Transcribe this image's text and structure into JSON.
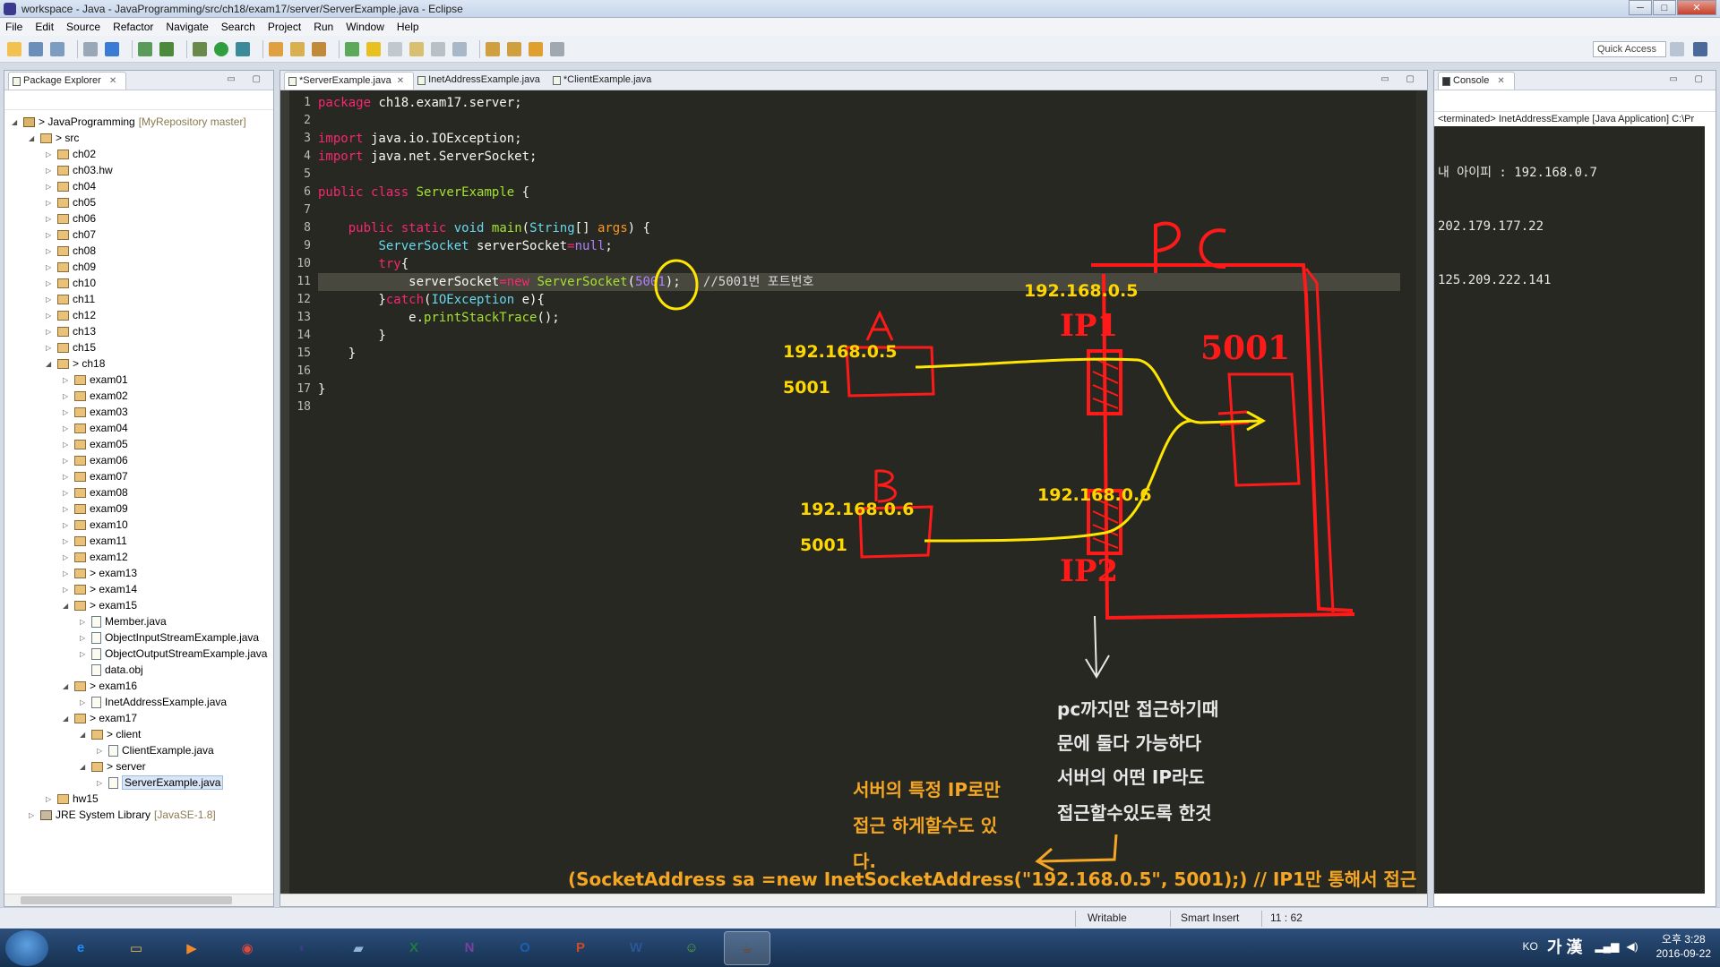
{
  "window": {
    "title": "workspace - Java - JavaProgramming/src/ch18/exam17/server/ServerExample.java - Eclipse",
    "controls": [
      "─",
      "□",
      "✕"
    ]
  },
  "menu": [
    "File",
    "Edit",
    "Source",
    "Refactor",
    "Navigate",
    "Search",
    "Project",
    "Run",
    "Window",
    "Help"
  ],
  "toolbar": {
    "quick_access": "Quick Access"
  },
  "package_explorer": {
    "tab_label": "Package Explorer",
    "close_glyph": "✕",
    "items": [
      {
        "label": "> JavaProgramming",
        "decoration": "[MyRepository master]",
        "depth": 0,
        "type": "proj",
        "arrow": "◢"
      },
      {
        "label": "> src",
        "depth": 1,
        "type": "pkg",
        "arrow": "◢"
      },
      {
        "label": "ch02",
        "depth": 2,
        "type": "pkg",
        "arrow": "▷"
      },
      {
        "label": "ch03.hw",
        "depth": 2,
        "type": "pkg",
        "arrow": "▷"
      },
      {
        "label": "ch04",
        "depth": 2,
        "type": "pkg",
        "arrow": "▷"
      },
      {
        "label": "ch05",
        "depth": 2,
        "type": "pkg",
        "arrow": "▷"
      },
      {
        "label": "ch06",
        "depth": 2,
        "type": "pkg",
        "arrow": "▷"
      },
      {
        "label": "ch07",
        "depth": 2,
        "type": "pkg",
        "arrow": "▷"
      },
      {
        "label": "ch08",
        "depth": 2,
        "type": "pkg",
        "arrow": "▷"
      },
      {
        "label": "ch09",
        "depth": 2,
        "type": "pkg",
        "arrow": "▷"
      },
      {
        "label": "ch10",
        "depth": 2,
        "type": "pkg",
        "arrow": "▷"
      },
      {
        "label": "ch11",
        "depth": 2,
        "type": "pkg",
        "arrow": "▷"
      },
      {
        "label": "ch12",
        "depth": 2,
        "type": "pkg",
        "arrow": "▷"
      },
      {
        "label": "ch13",
        "depth": 2,
        "type": "pkg",
        "arrow": "▷"
      },
      {
        "label": "ch15",
        "depth": 2,
        "type": "pkg",
        "arrow": "▷"
      },
      {
        "label": "> ch18",
        "depth": 2,
        "type": "pkg",
        "arrow": "◢"
      },
      {
        "label": "exam01",
        "depth": 3,
        "type": "pkg",
        "arrow": "▷"
      },
      {
        "label": "exam02",
        "depth": 3,
        "type": "pkg",
        "arrow": "▷"
      },
      {
        "label": "exam03",
        "depth": 3,
        "type": "pkg",
        "arrow": "▷"
      },
      {
        "label": "exam04",
        "depth": 3,
        "type": "pkg",
        "arrow": "▷"
      },
      {
        "label": "exam05",
        "depth": 3,
        "type": "pkg",
        "arrow": "▷"
      },
      {
        "label": "exam06",
        "depth": 3,
        "type": "pkg",
        "arrow": "▷"
      },
      {
        "label": "exam07",
        "depth": 3,
        "type": "pkg",
        "arrow": "▷"
      },
      {
        "label": "exam08",
        "depth": 3,
        "type": "pkg",
        "arrow": "▷"
      },
      {
        "label": "exam09",
        "depth": 3,
        "type": "pkg",
        "arrow": "▷"
      },
      {
        "label": "exam10",
        "depth": 3,
        "type": "pkg",
        "arrow": "▷"
      },
      {
        "label": "exam11",
        "depth": 3,
        "type": "pkg",
        "arrow": "▷"
      },
      {
        "label": "exam12",
        "depth": 3,
        "type": "pkg",
        "arrow": "▷"
      },
      {
        "label": "> exam13",
        "depth": 3,
        "type": "pkg",
        "arrow": "▷"
      },
      {
        "label": "> exam14",
        "depth": 3,
        "type": "pkg",
        "arrow": "▷"
      },
      {
        "label": "> exam15",
        "depth": 3,
        "type": "pkg",
        "arrow": "◢"
      },
      {
        "label": "Member.java",
        "depth": 4,
        "type": "file",
        "arrow": "▷"
      },
      {
        "label": "ObjectInputStreamExample.java",
        "depth": 4,
        "type": "file",
        "arrow": "▷"
      },
      {
        "label": "ObjectOutputStreamExample.java",
        "depth": 4,
        "type": "file",
        "arrow": "▷"
      },
      {
        "label": "data.obj",
        "depth": 4,
        "type": "file",
        "arrow": ""
      },
      {
        "label": "> exam16",
        "depth": 3,
        "type": "pkg",
        "arrow": "◢"
      },
      {
        "label": "InetAddressExample.java",
        "depth": 4,
        "type": "file",
        "arrow": "▷"
      },
      {
        "label": "> exam17",
        "depth": 3,
        "type": "pkg",
        "arrow": "◢"
      },
      {
        "label": "> client",
        "depth": 4,
        "type": "pkg",
        "arrow": "◢"
      },
      {
        "label": "ClientExample.java",
        "depth": 5,
        "type": "file",
        "arrow": "▷"
      },
      {
        "label": "> server",
        "depth": 4,
        "type": "pkg",
        "arrow": "◢"
      },
      {
        "label": "ServerExample.java",
        "depth": 5,
        "type": "file",
        "arrow": "▷",
        "selected": true
      },
      {
        "label": "hw15",
        "depth": 2,
        "type": "pkg",
        "arrow": "▷"
      },
      {
        "label": "JRE System Library",
        "decoration": "[JavaSE-1.8]",
        "depth": 1,
        "type": "lib",
        "arrow": "▷"
      }
    ]
  },
  "editor": {
    "tabs": [
      {
        "label": "*ServerExample.java",
        "active": true,
        "close": "✕"
      },
      {
        "label": "InetAddressExample.java",
        "active": false,
        "close": ""
      },
      {
        "label": "*ClientExample.java",
        "active": false,
        "close": ""
      }
    ],
    "line_numbers": [
      "1",
      "2",
      "3",
      "4",
      "5",
      "6",
      "7",
      "8",
      "9",
      "10",
      "11",
      "12",
      "13",
      "14",
      "15",
      "16",
      "17",
      "18"
    ],
    "highlighted_line": 11,
    "lines": [
      [
        {
          "t": "package",
          "c": "kw"
        },
        {
          "t": " ch18.exam17.server;",
          "c": "pu"
        }
      ],
      [],
      [
        {
          "t": "import",
          "c": "kw"
        },
        {
          "t": " java.io.IOException;",
          "c": "pu"
        }
      ],
      [
        {
          "t": "import",
          "c": "kw"
        },
        {
          "t": " java.net.ServerSocket;",
          "c": "pu"
        }
      ],
      [],
      [
        {
          "t": "public",
          "c": "kw"
        },
        {
          "t": " ",
          "c": "pu"
        },
        {
          "t": "class",
          "c": "kw"
        },
        {
          "t": " ",
          "c": "pu"
        },
        {
          "t": "ServerExample",
          "c": "fn"
        },
        {
          "t": " {",
          "c": "pu"
        }
      ],
      [],
      [
        {
          "t": "    ",
          "c": "pu"
        },
        {
          "t": "public",
          "c": "kw"
        },
        {
          "t": " ",
          "c": "pu"
        },
        {
          "t": "static",
          "c": "kw"
        },
        {
          "t": " ",
          "c": "pu"
        },
        {
          "t": "void",
          "c": "ty"
        },
        {
          "t": " ",
          "c": "pu"
        },
        {
          "t": "main",
          "c": "fn"
        },
        {
          "t": "(",
          "c": "pu"
        },
        {
          "t": "String",
          "c": "ty"
        },
        {
          "t": "[] ",
          "c": "pu"
        },
        {
          "t": "args",
          "c": "vr"
        },
        {
          "t": ") {",
          "c": "pu"
        }
      ],
      [
        {
          "t": "        ",
          "c": "pu"
        },
        {
          "t": "ServerSocket",
          "c": "ty"
        },
        {
          "t": " serverSocket",
          "c": "pu"
        },
        {
          "t": "=",
          "c": "kw"
        },
        {
          "t": "null",
          "c": "nm"
        },
        {
          "t": ";",
          "c": "pu"
        }
      ],
      [
        {
          "t": "        ",
          "c": "pu"
        },
        {
          "t": "try",
          "c": "kw"
        },
        {
          "t": "{",
          "c": "pu"
        }
      ],
      [
        {
          "t": "            serverSocket",
          "c": "pu"
        },
        {
          "t": "=",
          "c": "kw"
        },
        {
          "t": "new",
          "c": "kw"
        },
        {
          "t": " ",
          "c": "pu"
        },
        {
          "t": "ServerSocket",
          "c": "fn"
        },
        {
          "t": "(",
          "c": "pu"
        },
        {
          "t": "5001",
          "c": "nm"
        },
        {
          "t": ");",
          "c": "pu"
        },
        {
          "t": "   //5001번 포트번호",
          "c": "cm"
        }
      ],
      [
        {
          "t": "        }",
          "c": "pu"
        },
        {
          "t": "catch",
          "c": "kw"
        },
        {
          "t": "(",
          "c": "pu"
        },
        {
          "t": "IOException",
          "c": "ty"
        },
        {
          "t": " e){",
          "c": "pu"
        }
      ],
      [
        {
          "t": "            e.",
          "c": "pu"
        },
        {
          "t": "printStackTrace",
          "c": "fn"
        },
        {
          "t": "();",
          "c": "pu"
        }
      ],
      [
        {
          "t": "        }",
          "c": "pu"
        }
      ],
      [
        {
          "t": "    }",
          "c": "pu"
        }
      ],
      [],
      [
        {
          "t": "}",
          "c": "pu"
        }
      ],
      []
    ]
  },
  "console": {
    "tab_label": "Console",
    "close_glyph": "✕",
    "terminated": "<terminated> InetAddressExample [Java Application] C:\\Pr",
    "output": [
      "내 아이피 : 192.168.0.7",
      "202.179.177.22",
      "125.209.222.141"
    ]
  },
  "statusbar": {
    "writable": "Writable",
    "insert_mode": "Smart Insert",
    "position": "11 : 62"
  },
  "taskbar": {
    "apps": [
      {
        "name": "internet-explorer",
        "glyph": "e",
        "color": "#1e90ff"
      },
      {
        "name": "file-explorer",
        "glyph": "▭",
        "color": "#e8b84a"
      },
      {
        "name": "media-player",
        "glyph": "▶",
        "color": "#f08a2c"
      },
      {
        "name": "chrome",
        "glyph": "◉",
        "color": "#e04a3c"
      },
      {
        "name": "eclipse",
        "glyph": "◐",
        "color": "#3b3a8f"
      },
      {
        "name": "notes",
        "glyph": "▰",
        "color": "#8fb6d8"
      },
      {
        "name": "excel",
        "glyph": "X",
        "color": "#1f7a3d"
      },
      {
        "name": "onenote",
        "glyph": "N",
        "color": "#7b3fa0"
      },
      {
        "name": "outlook",
        "glyph": "O",
        "color": "#1b5fb0"
      },
      {
        "name": "powerpoint",
        "glyph": "P",
        "color": "#d04a24"
      },
      {
        "name": "word",
        "glyph": "W",
        "color": "#2b5797"
      },
      {
        "name": "frog-app",
        "glyph": "☺",
        "color": "#5aa83a"
      },
      {
        "name": "java-ee-ide",
        "glyph": "☕",
        "color": "#6a4a2a"
      }
    ],
    "lang": "KO",
    "ime": "가 漢",
    "time": "오후 3:28",
    "date": "2016-09-22"
  },
  "annotations": {
    "pc_label": "PC",
    "a_label": "A",
    "b_label": "B",
    "ip1_label": "IP1",
    "ip2_label": "IP2",
    "port_label": "5001",
    "ip_top": "192.168.0.5",
    "ip_bottom": "192.168.0.6",
    "a_ip": "192.168.0.5",
    "a_port": "5001",
    "b_ip": "192.168.0.6",
    "b_port": "5001",
    "note_white": [
      "pc까지만 접근하기때",
      "문에 둘다 가능하다",
      "서버의 어떤 IP라도",
      "접근할수있도록 한것"
    ],
    "note_orange": [
      "서버의 특정 IP로만",
      "접근 하게할수도 있",
      "다."
    ],
    "code_note": "(SocketAddress sa =new InetSocketAddress(\"192.168.0.5\", 5001);)   // IP1만 통해서 접근"
  }
}
